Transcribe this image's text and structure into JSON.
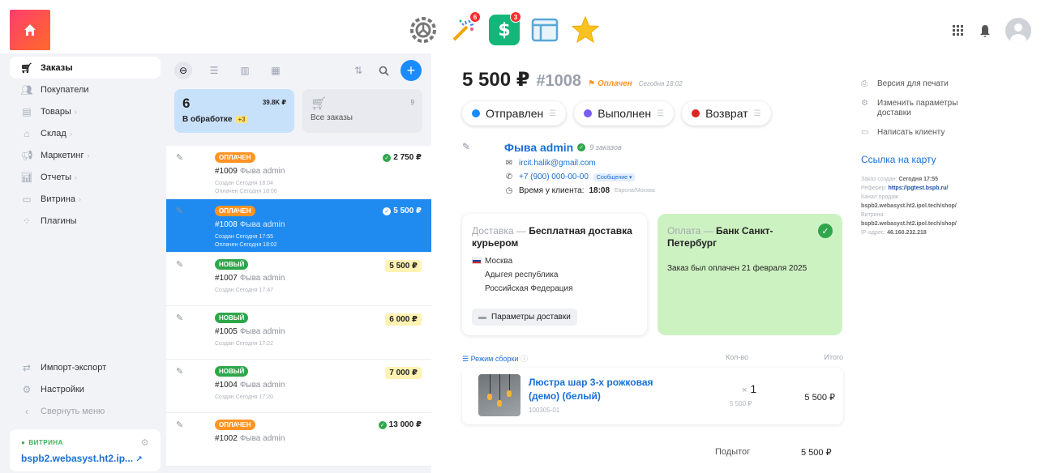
{
  "topbar": {
    "apps": [
      {
        "name": "gear-app-icon",
        "badge": ""
      },
      {
        "name": "magic-wand-app-icon",
        "badge": "6"
      },
      {
        "name": "shop-app-icon",
        "badge": "3"
      },
      {
        "name": "site-app-icon",
        "badge": ""
      },
      {
        "name": "star-app-icon",
        "badge": ""
      }
    ]
  },
  "sidebar": {
    "items": [
      {
        "label": "Заказы",
        "icon": "cart-icon",
        "active": true
      },
      {
        "label": "Покупатели",
        "icon": "users-icon"
      },
      {
        "label": "Товары",
        "icon": "products-icon",
        "chevron": "›"
      },
      {
        "label": "Склад",
        "icon": "warehouse-icon",
        "chevron": "›"
      },
      {
        "label": "Маркетинг",
        "icon": "megaphone-icon",
        "chevron": "›"
      },
      {
        "label": "Отчеты",
        "icon": "chart-icon",
        "chevron": "›"
      },
      {
        "label": "Витрина",
        "icon": "storefront-icon",
        "chevron": "›"
      },
      {
        "label": "Плагины",
        "icon": "plugins-icon"
      }
    ],
    "bottom": [
      {
        "label": "Импорт-экспорт",
        "icon": "import-export-icon"
      },
      {
        "label": "Настройки",
        "icon": "settings-icon"
      },
      {
        "label": "Свернуть меню",
        "icon": "collapse-icon"
      }
    ],
    "storefront": {
      "label": "ВИТРИНА",
      "url": "bspb2.webasyst.ht2.ip..."
    }
  },
  "orderlist": {
    "processing": {
      "count": "6",
      "amount": "39.8K ₽",
      "label": "В обработке",
      "delta": "+3"
    },
    "all": {
      "count": "9",
      "label": "Все заказы"
    },
    "orders": [
      {
        "status": "оплачен",
        "kind": "paid",
        "number": "#1009",
        "customer": "Фыва admin",
        "created": "Создан Сегодня 18:04",
        "extra": "Оплачен Сегодня 18:06",
        "price": "2 750 ₽",
        "check": true,
        "selected": false
      },
      {
        "status": "оплачен",
        "kind": "paid",
        "number": "#1008",
        "customer": "Фыва admin",
        "created": "Создан Сегодня 17:55",
        "extra": "Оплачен Сегодня 18:02",
        "price": "5 500 ₽",
        "check": true,
        "selected": true
      },
      {
        "status": "новый",
        "kind": "new",
        "number": "#1007",
        "customer": "Фыва admin",
        "created": "Создан Сегодня 17:47",
        "extra": "",
        "price": "5 500 ₽",
        "check": false,
        "selected": false
      },
      {
        "status": "новый",
        "kind": "new",
        "number": "#1005",
        "customer": "Фыва admin",
        "created": "Создан Сегодня 17:22",
        "extra": "",
        "price": "6 000 ₽",
        "check": false,
        "selected": false
      },
      {
        "status": "новый",
        "kind": "new",
        "number": "#1004",
        "customer": "Фыва admin",
        "created": "Создан Сегодня 17:20",
        "extra": "",
        "price": "7 000 ₽",
        "check": false,
        "selected": false
      },
      {
        "status": "оплачен",
        "kind": "paid",
        "number": "#1002",
        "customer": "Фыва admin",
        "created": "",
        "extra": "",
        "price": "13 000 ₽",
        "check": true,
        "selected": false
      }
    ]
  },
  "detail": {
    "total": "5 500 ₽",
    "number": "#1008",
    "status": "Оплачен",
    "date": "Сегодня 18:02",
    "actions": [
      {
        "label": "Отправлен",
        "color": "#1a8cff"
      },
      {
        "label": "Выполнен",
        "color": "#7b5cf0"
      },
      {
        "label": "Возврат",
        "color": "#e02424"
      }
    ],
    "customer": {
      "name": "Фыва admin",
      "orders": "9 заказов",
      "email": "ircit.halik@gmail.com",
      "phone": "+7 (900) 000-00-00",
      "message_btn": "Сообщение",
      "time_label": "Время у клиента:",
      "time": "18:08",
      "tz": "Европа/Москва"
    },
    "delivery": {
      "label": "Доставка —",
      "title": "Бесплатная доставка курьером",
      "city": "Москва",
      "region": "Адыгея республика",
      "country": "Российская Федерация",
      "button": "Параметры доставки"
    },
    "payment": {
      "label": "Оплата —",
      "title": "Банк Санкт-Петербург",
      "note": "Заказ был оплачен 21 февраля 2025"
    },
    "items_head": {
      "mode": "Режим сборки",
      "qty": "Кол-во",
      "total": "Итого"
    },
    "item": {
      "name": "Люстра шар 3-х рожковая (демо) (белый)",
      "sku": "100305-01",
      "qty": "1",
      "unit_price": "5 500 ₽",
      "total": "5 500 ₽"
    },
    "subtotal_label": "Подытог",
    "subtotal": "5 500 ₽",
    "right": {
      "print": "Версия для печати",
      "change_delivery": "Изменить параметры доставки",
      "write_client": "Написать клиенту",
      "map_link": "Ссылка на карту",
      "meta_created_label": "Заказ создан:",
      "meta_created": "Сегодня 17:55",
      "meta_ref_label": "Реферер:",
      "meta_ref": "https://pgtest.bspb.ru/",
      "meta_channel_label": "Канал продаж:",
      "meta_channel": "bspb2.webasyst.ht2.ipol.tech/shop/",
      "meta_storefront_label": "Витрина:",
      "meta_storefront": "bspb2.webasyst.ht2.ipol.tech/shop/",
      "meta_ip_label": "IP-адрес:",
      "meta_ip": "46.160.232.218"
    }
  }
}
